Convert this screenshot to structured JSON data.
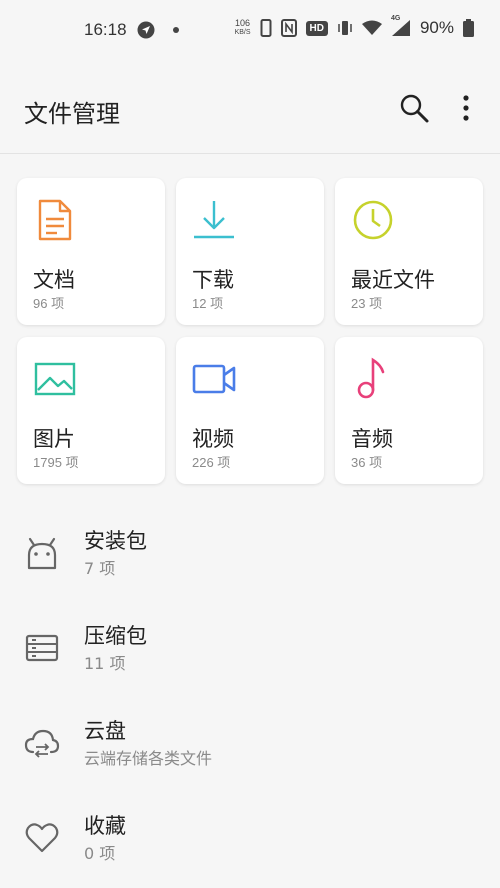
{
  "status_bar": {
    "time": "16:18",
    "net_speed_value": "106",
    "net_speed_unit": "KB/S",
    "hd_badge": "HD",
    "network": "4G",
    "battery": "90%"
  },
  "header": {
    "title": "文件管理"
  },
  "categories": [
    {
      "label": "文档",
      "count": "96 项",
      "icon": "document-icon",
      "color": "#f08a3c"
    },
    {
      "label": "下载",
      "count": "12 项",
      "icon": "download-icon",
      "color": "#3bbfcf"
    },
    {
      "label": "最近文件",
      "count": "23 项",
      "icon": "clock-icon",
      "color": "#c6d22c"
    },
    {
      "label": "图片",
      "count": "1795 项",
      "icon": "image-icon",
      "color": "#2fbf9f"
    },
    {
      "label": "视频",
      "count": "226 项",
      "icon": "video-icon",
      "color": "#4a7de8"
    },
    {
      "label": "音频",
      "count": "36 项",
      "icon": "music-note-icon",
      "color": "#e8407a"
    }
  ],
  "list": [
    {
      "label": "安装包",
      "sub": "7 项",
      "icon": "android-icon"
    },
    {
      "label": "压缩包",
      "sub": "11 项",
      "icon": "archive-icon"
    },
    {
      "label": "云盘",
      "sub": "云端存储各类文件",
      "icon": "cloud-icon"
    },
    {
      "label": "收藏",
      "sub": "0 项",
      "icon": "heart-icon"
    }
  ]
}
